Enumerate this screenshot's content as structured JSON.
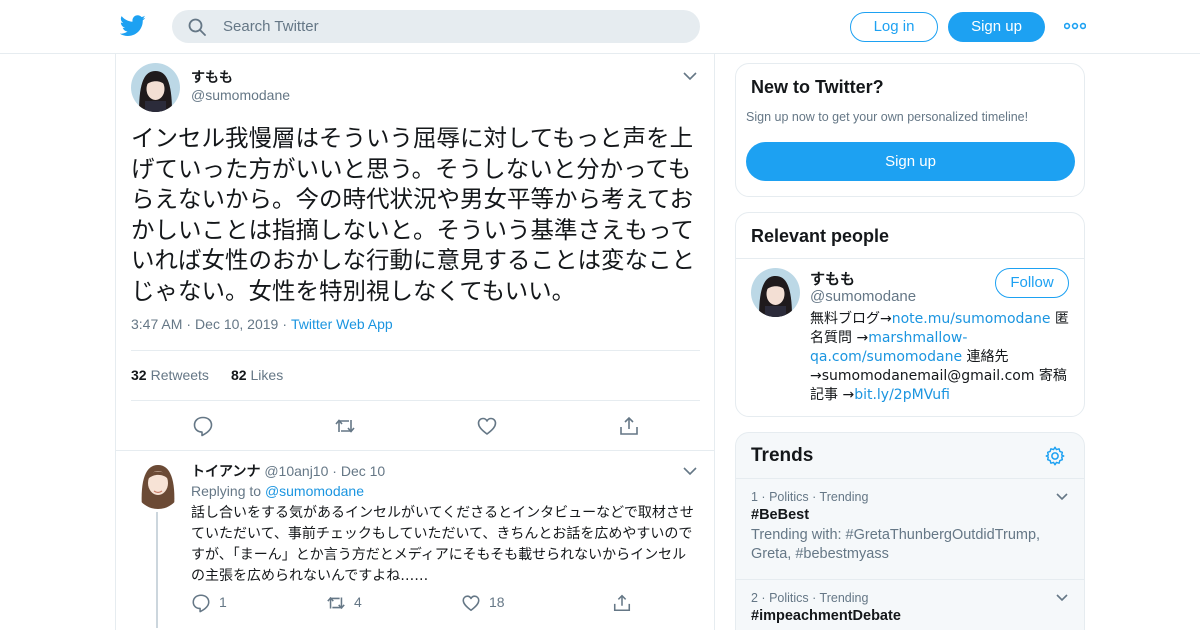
{
  "header": {
    "search_placeholder": "Search Twitter",
    "login_label": "Log in",
    "signup_label": "Sign up"
  },
  "tweet": {
    "name": "すもも",
    "handle": "@sumomodane",
    "text": "インセル我慢層はそういう屈辱に対してもっと声を上げていった方がいいと思う。そうしないと分かってもらえないから。今の時代状況や男女平等から考えておかしいことは指摘しないと。そういう基準さえもっていれば女性のおかしな行動に意見することは変なことじゃない。女性を特別視しなくてもいい。",
    "time": "3:47 AM",
    "date": "Dec 10, 2019",
    "source": "Twitter Web App",
    "retweets_count": "32",
    "retweets_label": "Retweets",
    "likes_count": "82",
    "likes_label": "Likes"
  },
  "reply": {
    "name": "トイアンナ",
    "handle": "@10anj10",
    "date": "Dec 10",
    "replying_prefix": "Replying to",
    "replying_to": "@sumomodane",
    "text": "話し合いをする気があるインセルがいてくださるとインタビューなどで取材させていただいて、事前チェックもしていただいて、きちんとお話を広めやすいのですが、「まーん」とか言う方だとメディアにそもそも載せられないからインセルの主張を広められないんですよね……",
    "reply_count": "1",
    "retweet_count": "4",
    "like_count": "18"
  },
  "new_to_twitter": {
    "title": "New to Twitter?",
    "subtitle": "Sign up now to get your own personalized timeline!",
    "button": "Sign up"
  },
  "relevant_people": {
    "title": "Relevant people",
    "name": "すもも",
    "handle": "@sumomodane",
    "follow_label": "Follow",
    "bio_1": "無料ブログ→",
    "bio_link_1": "note.mu/sumomodane",
    "bio_2": " 匿名質問 →",
    "bio_link_2": "marshmallow-qa.com/sumomodane",
    "bio_3": " 連絡先→sumomodanemail@gmail.com 寄稿記事 →",
    "bio_link_3": "bit.ly/2pMVufi"
  },
  "trends": {
    "title": "Trends",
    "items": [
      {
        "rank": "1",
        "category": "Politics",
        "status": "Trending",
        "tag": "#BeBest",
        "with": "Trending with: #GretaThunbergOutdidTrump, Greta, #bebestmyass"
      },
      {
        "rank": "2",
        "category": "Politics",
        "status": "Trending",
        "tag": "#impeachmentDebate"
      }
    ]
  },
  "colors": {
    "brand": "#1da1f2",
    "link": "#1b95e0",
    "secondary_text": "#657786",
    "border": "#e6ecf0"
  }
}
